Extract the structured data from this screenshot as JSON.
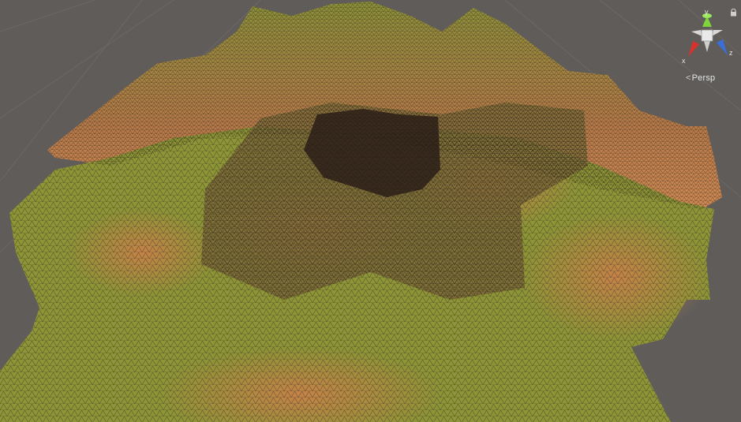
{
  "scene_view": {
    "projection_label": "Persp",
    "axes": {
      "x": "x",
      "y": "y",
      "z": "z"
    },
    "colors": {
      "background": "#5f5c5a",
      "grid_line": "#6e6b69",
      "terrain_grass": "#8e9438",
      "terrain_dirt": "#c8824a",
      "terrain_crater": "#3a2a1e",
      "wire": "#1c1a0e",
      "axis_x": "#d9322b",
      "axis_y": "#7ed43c",
      "axis_z": "#3a6fd8"
    },
    "icons": [
      "scene-gizmo-icon",
      "lock-icon"
    ]
  }
}
